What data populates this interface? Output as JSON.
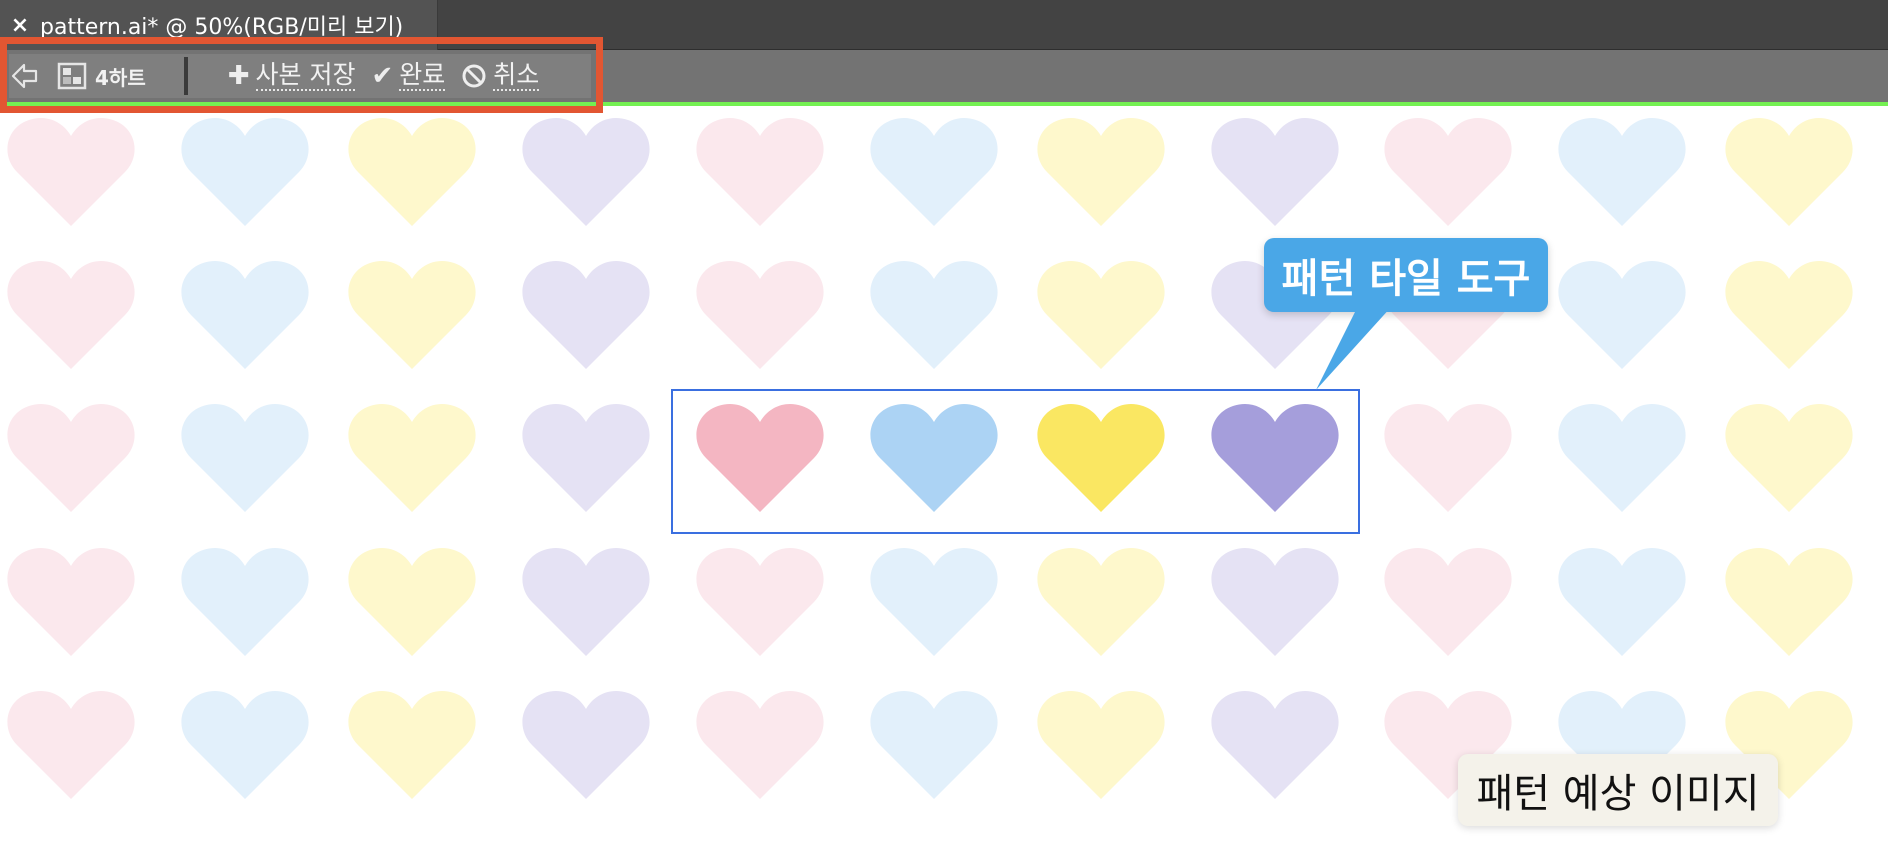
{
  "tab": {
    "close_symbol": "×",
    "title": "pattern.ai* @ 50%(RGB/미리 보기)"
  },
  "toolbar": {
    "tile_name": "4하트",
    "save_copy_label": "사본 저장",
    "done_label": "완료",
    "cancel_label": "취소",
    "icons": [
      "back-arrow-icon",
      "pattern-tile-icon",
      "plus-icon",
      "checkmark-icon",
      "cancel-circle-icon"
    ]
  },
  "colors": {
    "highlight": "#e25632",
    "mode_bar_accent": "#74f052",
    "selection": "#3a6fe0",
    "heart_pink": "#f4b6c2",
    "heart_blue": "#acd3f4",
    "heart_yellow": "#fae762",
    "heart_purple": "#a59edb",
    "heart_pink_light": "#fbe8ed",
    "heart_blue_light": "#e2f0fb",
    "heart_yellow_light": "#fef8cc",
    "heart_purple_light": "#e5e2f4"
  },
  "pattern": {
    "tile_colors": [
      "pink",
      "blue",
      "yellow",
      "purple"
    ]
  },
  "callouts": {
    "tool_label": "패턴 타일 도구",
    "preview_label": "패턴 예상 이미지"
  }
}
